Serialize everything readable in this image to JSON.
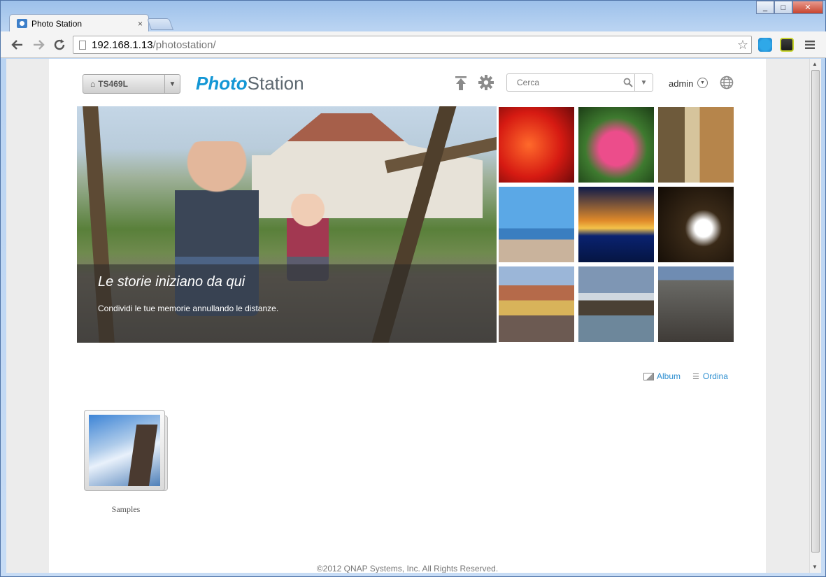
{
  "browser": {
    "tab_title": "Photo Station",
    "tab_close": "×",
    "url_host": "192.168.1.13",
    "url_path": "/photostation/",
    "minimize": "_",
    "maximize": "□",
    "close": "✕"
  },
  "header": {
    "nas_name": "TS469L",
    "logo_part1": "Photo",
    "logo_part2": "Station",
    "search_placeholder": "Cerca",
    "user": "admin"
  },
  "hero": {
    "title": "Le storie iniziano da qui",
    "subtitle": "Condividi le tue memorie annullando le distanze."
  },
  "view_controls": {
    "album_label": "Album",
    "sort_label": "Ordina"
  },
  "folders": [
    {
      "label": "Samples"
    }
  ],
  "footer": {
    "copyright": "©2012 QNAP Systems, Inc. All Rights Reserved."
  },
  "colors": {
    "accent_blue": "#1497d5",
    "link_blue": "#2e8fd0"
  }
}
